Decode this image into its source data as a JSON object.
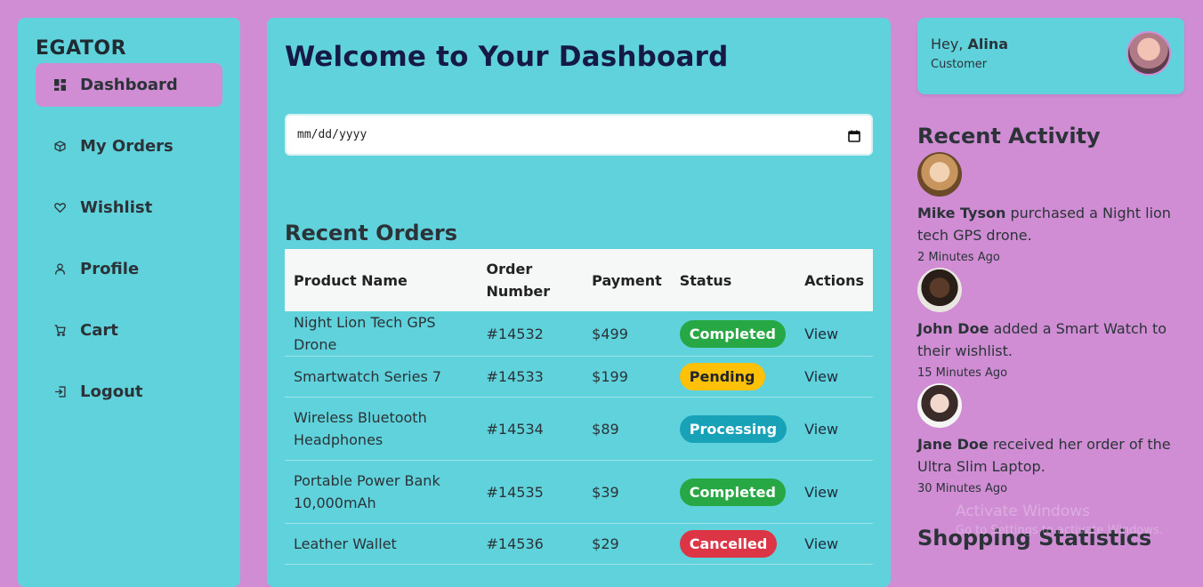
{
  "sidebar": {
    "brand": "EGATOR",
    "items": [
      {
        "label": "Dashboard",
        "icon": "dashboard-icon",
        "active": true
      },
      {
        "label": "My Orders",
        "icon": "box-icon",
        "active": false
      },
      {
        "label": "Wishlist",
        "icon": "heart-icon",
        "active": false
      },
      {
        "label": "Profile",
        "icon": "user-icon",
        "active": false
      },
      {
        "label": "Cart",
        "icon": "cart-icon",
        "active": false
      },
      {
        "label": "Logout",
        "icon": "logout-icon",
        "active": false
      }
    ]
  },
  "main": {
    "title": "Welcome to Your Dashboard",
    "date_input": {
      "placeholder": "mm/dd/yyyy"
    },
    "orders_title": "Recent Orders",
    "columns": [
      "Product Name",
      "Order Number",
      "Payment",
      "Status",
      "Actions"
    ],
    "orders": [
      {
        "product": "Night Lion Tech GPS Drone",
        "order": "#14532",
        "payment": "$499",
        "status": "Completed",
        "action": "View"
      },
      {
        "product": "Smartwatch Series 7",
        "order": "#14533",
        "payment": "$199",
        "status": "Pending",
        "action": "View"
      },
      {
        "product": "Wireless Bluetooth Headphones",
        "order": "#14534",
        "payment": "$89",
        "status": "Processing",
        "action": "View"
      },
      {
        "product": "Portable Power Bank 10,000mAh",
        "order": "#14535",
        "payment": "$39",
        "status": "Completed",
        "action": "View"
      },
      {
        "product": "Leather Wallet",
        "order": "#14536",
        "payment": "$29",
        "status": "Cancelled",
        "action": "View"
      }
    ]
  },
  "user": {
    "greeting": "Hey,",
    "name": "Alina",
    "role": "Customer"
  },
  "activity": {
    "title": "Recent Activity",
    "items": [
      {
        "name": "Mike Tyson",
        "text": " purchased a Night lion tech GPS drone.",
        "time": "2 Minutes Ago"
      },
      {
        "name": "John Doe",
        "text": " added a Smart Watch to their wishlist.",
        "time": "15 Minutes Ago"
      },
      {
        "name": "Jane Doe",
        "text": " received her order of the Ultra Slim Laptop.",
        "time": "30 Minutes Ago"
      }
    ]
  },
  "stats_title": "Shopping Statistics",
  "watermark": {
    "line1": "Activate Windows",
    "line2": "Go to Settings to activate Windows."
  },
  "colors": {
    "page_bg": "#d08dd4",
    "panel_bg": "#60d2db",
    "completed": "#28a745",
    "pending": "#ffc107",
    "processing": "#17a2b8",
    "cancelled": "#dc3545"
  }
}
